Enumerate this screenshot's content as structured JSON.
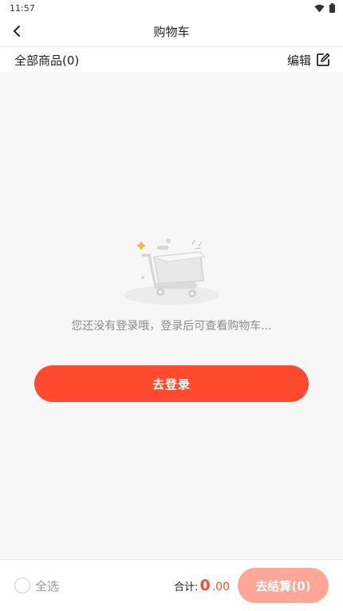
{
  "status_bar": {
    "time": "11:57"
  },
  "nav": {
    "title": "购物车"
  },
  "sub_header": {
    "all_goods": "全部商品(0)",
    "edit_label": "编辑"
  },
  "empty_state": {
    "message": "您还没有登录哦，登录后可查看购物车...",
    "login_button": "去登录"
  },
  "bottom_bar": {
    "select_all": "全选",
    "total_label": "合计:",
    "total_int": "0",
    "total_dec": ".00",
    "checkout_button": "去结算(0)"
  },
  "colors": {
    "accent": "#ff4a2d",
    "accent_disabled": "#ffa697",
    "background": "#f7f7f7",
    "muted_text": "#8c8c8c"
  },
  "icons": [
    "wifi-icon",
    "battery-icon",
    "back-arrow-icon",
    "edit-icon",
    "shopping-cart-illustration"
  ]
}
